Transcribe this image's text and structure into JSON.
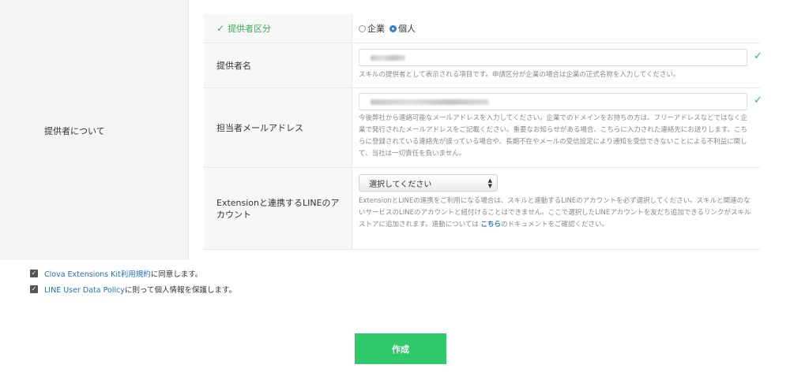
{
  "section": {
    "label": "提供者について"
  },
  "provider_type": {
    "label": "提供者区分",
    "options": [
      {
        "label": "企業",
        "selected": false
      },
      {
        "label": "個人",
        "selected": true
      }
    ]
  },
  "provider_name": {
    "label": "提供者名",
    "help": "スキルの提供者として表示される項目です。申請区分が企業の場合は企業の正式名称を入力してください。"
  },
  "contact_email": {
    "label": "担当者メールアドレス",
    "help": "今後弊社から連絡可能なメールアドレスを入力してください。企業でのドメインをお持ちの方は、フリーアドレスなどではなく企業で発行されたメールアドレスをご記載ください。重要なお知らせがある場合、こちらに入力された連絡先にお送りします。こちらに登録されている連絡先が誤っている場合や、長期不在やメールの受信設定により通知を受信できないことによる不利益に関して、当社は一切責任を負いません。"
  },
  "line_account": {
    "label": "Extensionと連携するLINEのアカウント",
    "select_value": "選択してください",
    "help_before": "ExtensionとLINEの連携をご利用になる場合は、スキルと連動するLINEのアカウントを必ず選択してください。スキルと関連のないサービスのLINEのアカウントと紐付けることはできません。ここで選択したLINEアカウントを友だち追加できるリンクがスキルストアに追加されます。連動については ",
    "help_link": "こちら",
    "help_after": "のドキュメントをご確認ください。"
  },
  "agreements": [
    {
      "link": "Clova Extensions Kit利用規約",
      "text": "に同意します。",
      "checked": true
    },
    {
      "link": "LINE User Data Policy",
      "text": "に則って個人情報を保護します。",
      "checked": true
    }
  ],
  "submit_label": "作成",
  "colors": {
    "accent_green": "#2fc86a",
    "link_blue": "#1f6fc5"
  }
}
